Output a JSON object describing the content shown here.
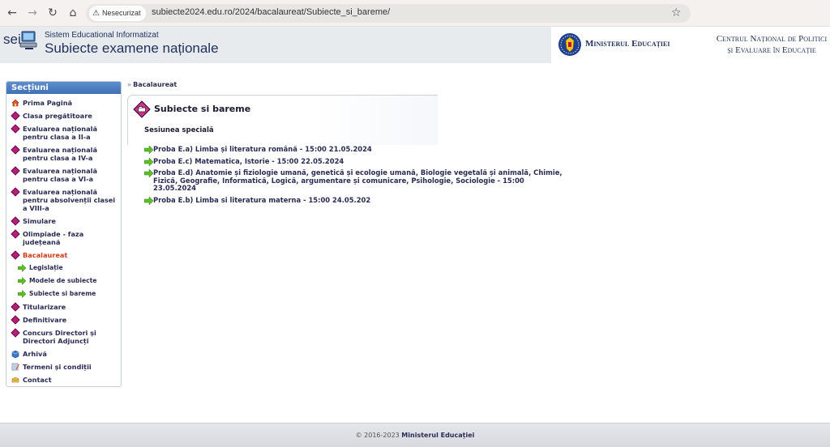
{
  "browser": {
    "security_label": "Nesecurizat",
    "url": "subiecte2024.edu.ro/2024/bacalaureat/Subiecte_si_bareme/"
  },
  "header": {
    "logo_abbr": "sei",
    "logo_small": "Sistem Educational Informatizat",
    "logo_big": "Subiecte examene naționale",
    "ministry": "Ministerul Educației",
    "cnpee_line1": "Centrul Național de Politici",
    "cnpee_line2": "și Evaluare în Educație"
  },
  "sidebar": {
    "title": "Secțiuni",
    "items": [
      {
        "label": "Prima Pagină",
        "icon": "home-icon"
      },
      {
        "label": "Clasa pregătitoare",
        "icon": "diamond-icon"
      },
      {
        "label": "Evaluarea națională pentru clasa a II-a",
        "icon": "diamond-icon"
      },
      {
        "label": "Evaluarea națională pentru clasa a IV-a",
        "icon": "diamond-icon"
      },
      {
        "label": "Evaluarea națională pentru clasa a VI-a",
        "icon": "diamond-icon"
      },
      {
        "label": "Evaluarea națională pentru absolvenții clasei a VIII-a",
        "icon": "diamond-icon"
      },
      {
        "label": "Simulare",
        "icon": "diamond-icon"
      },
      {
        "label": "Olimpiade - faza județeană",
        "icon": "diamond-icon"
      },
      {
        "label": "Bacalaureat",
        "icon": "diamond-icon"
      },
      {
        "label": "Legislație",
        "icon": "arrow-right-icon"
      },
      {
        "label": "Modele de subiecte",
        "icon": "arrow-right-icon"
      },
      {
        "label": "Subiecte si bareme",
        "icon": "arrow-right-icon"
      },
      {
        "label": "Titularizare",
        "icon": "diamond-icon"
      },
      {
        "label": "Definitivare",
        "icon": "diamond-icon"
      },
      {
        "label": "Concurs Directori și Directori Adjuncți",
        "icon": "diamond-icon"
      },
      {
        "label": "Arhivă",
        "icon": "archive-icon"
      },
      {
        "label": "Termeni și condiții",
        "icon": "notepad-icon"
      },
      {
        "label": "Contact",
        "icon": "contact-icon"
      }
    ]
  },
  "main": {
    "breadcrumb": "Bacalaureat",
    "section_title": "Subiecte si bareme",
    "session": "Sesiunea specială",
    "tests": [
      "Proba E.a) Limba și literatura română - 15:00 21.05.2024",
      "Proba E.c) Matematica, Istorie - 15:00 22.05.2024",
      "Proba E.d) Anatomie și fiziologie umană, genetică și ecologie umană, Biologie vegetală și animală, Chimie, Fizică, Geografie, Informatică, Logică, argumentare și comunicare, Psihologie, Sociologie - 15:00 23.05.2024",
      "Proba E.b) Limba si literatura materna - 15:00 24.05.202"
    ]
  },
  "footer": {
    "copyright": "© 2016-2023",
    "owner": "Ministerul Educației"
  },
  "colors": {
    "active_link": "#cc3a1a",
    "text": "#2b2b55",
    "sidebar_header": "#4a7cc0"
  }
}
